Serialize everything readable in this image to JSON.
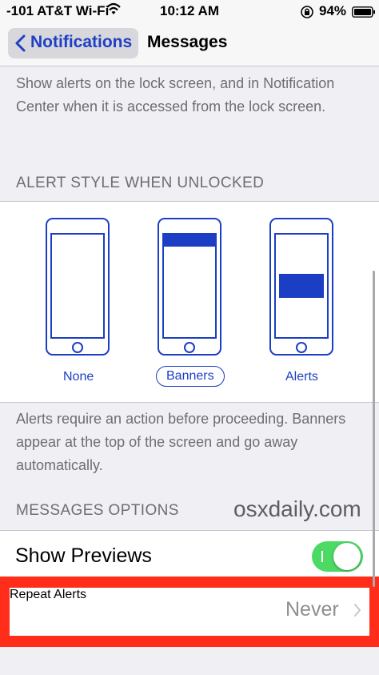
{
  "status_bar": {
    "carrier": "-101 AT&T Wi-Fi",
    "wifi_icon": "wifi-icon",
    "time": "10:12 AM",
    "lock_icon": "orientation-lock-icon",
    "battery_percent": "94%",
    "battery_icon": "battery-icon"
  },
  "nav": {
    "back_label": "Notifications",
    "title": "Messages"
  },
  "lock_screen_footer": "Show alerts on the lock screen, and in Notification Center when it is accessed from the lock screen.",
  "alert_style": {
    "header": "ALERT STYLE WHEN UNLOCKED",
    "options": [
      "None",
      "Banners",
      "Alerts"
    ],
    "selected": "Banners",
    "footer": "Alerts require an action before proceeding. Banners appear at the top of the screen and go away automatically."
  },
  "messages_options": {
    "header": "MESSAGES OPTIONS",
    "watermark": "osxdaily.com",
    "show_previews_label": "Show Previews",
    "show_previews_on": true,
    "repeat_alerts_label": "Repeat Alerts",
    "repeat_alerts_value": "Never"
  },
  "colors": {
    "accent": "#1c3ec4",
    "toggle_on": "#4cd964",
    "highlight": "#ff2d1a"
  }
}
